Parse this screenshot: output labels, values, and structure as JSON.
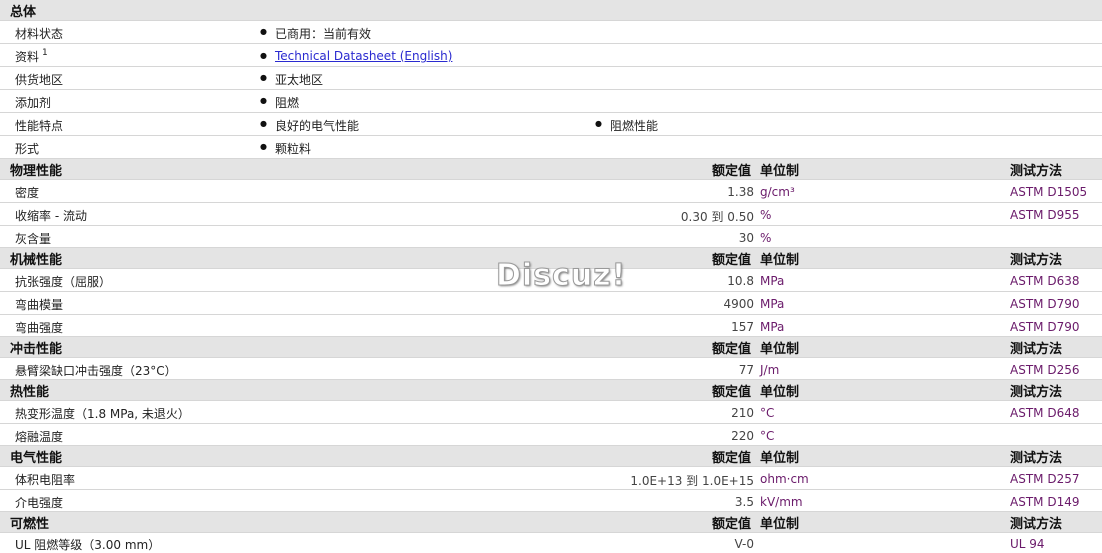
{
  "overview": {
    "title": "总体",
    "rows": [
      {
        "label": "材料状态",
        "items": [
          "已商用：当前有效"
        ]
      },
      {
        "label": "资料",
        "sup": "1",
        "link": "Technical Datasheet (English)"
      },
      {
        "label": "供货地区",
        "items": [
          "亚太地区"
        ]
      },
      {
        "label": "添加剂",
        "items": [
          "阻燃"
        ]
      },
      {
        "label": "性能特点",
        "items": [
          "良好的电气性能",
          "阻燃性能"
        ]
      },
      {
        "label": "形式",
        "items": [
          "颗粒料"
        ]
      }
    ]
  },
  "columns": {
    "nominal": "额定值",
    "unit": "单位制",
    "method": "测试方法"
  },
  "sections": [
    {
      "title": "物理性能",
      "rows": [
        {
          "label": "密度",
          "value": "1.38",
          "unit": "g/cm³",
          "method": "ASTM D1505"
        },
        {
          "label": "收缩率 - 流动",
          "value": "0.30 到  0.50",
          "unit": "%",
          "method": "ASTM D955"
        },
        {
          "label": "灰含量",
          "value": "30",
          "unit": "%",
          "method": ""
        }
      ]
    },
    {
      "title": "机械性能",
      "rows": [
        {
          "label": "抗张强度（屈服）",
          "value": "10.8",
          "unit": "MPa",
          "method": "ASTM D638"
        },
        {
          "label": "弯曲模量",
          "value": "4900",
          "unit": "MPa",
          "method": "ASTM D790"
        },
        {
          "label": "弯曲强度",
          "value": "157",
          "unit": "MPa",
          "method": "ASTM D790"
        }
      ]
    },
    {
      "title": "冲击性能",
      "rows": [
        {
          "label": "悬臂梁缺口冲击强度（23°C）",
          "value": "77",
          "unit": "J/m",
          "method": "ASTM D256"
        }
      ]
    },
    {
      "title": "热性能",
      "rows": [
        {
          "label": "热变形温度（1.8 MPa, 未退火）",
          "value": "210",
          "unit": "°C",
          "method": "ASTM D648"
        },
        {
          "label": "熔融温度",
          "value": "220",
          "unit": "°C",
          "method": ""
        }
      ]
    },
    {
      "title": "电气性能",
      "rows": [
        {
          "label": "体积电阻率",
          "value": "1.0E+13 到  1.0E+15",
          "unit": "ohm·cm",
          "method": "ASTM D257"
        },
        {
          "label": "介电强度",
          "value": "3.5",
          "unit": "kV/mm",
          "method": "ASTM D149"
        }
      ]
    },
    {
      "title": "可燃性",
      "rows": [
        {
          "label": "UL 阻燃等级（3.00 mm）",
          "value": "V-0",
          "unit": "",
          "method": "UL 94"
        }
      ]
    }
  ],
  "watermark": "Discuz!"
}
